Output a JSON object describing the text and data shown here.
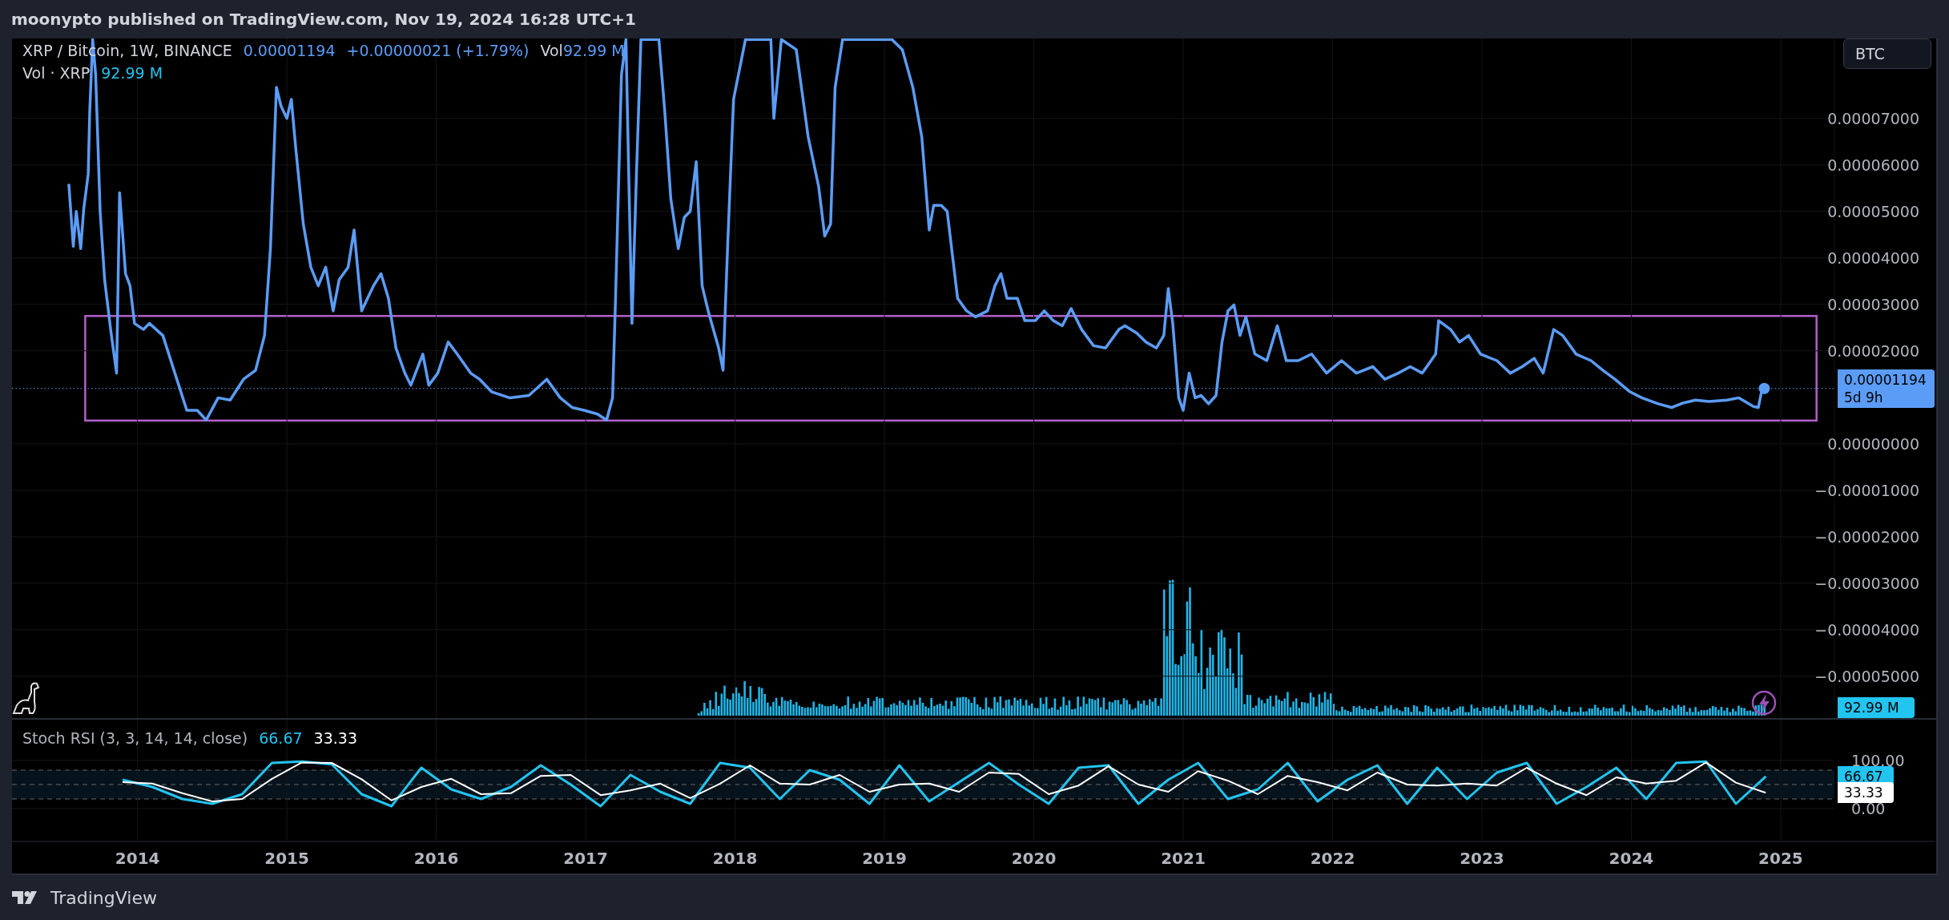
{
  "header": {
    "publisher_line": "moonypto published on TradingView.com, Nov 19, 2024 16:28 UTC+1"
  },
  "legend": {
    "symbol": "XRP / Bitcoin, 1W, BINANCE",
    "price": "0.00001194",
    "change": "+0.00000021 (+1.79%)",
    "volume_label": "Vol",
    "volume_value": "92.99 M"
  },
  "volume_legend": {
    "name": "Vol · XRP",
    "value": "92.99 M"
  },
  "currency_button": "BTC",
  "price_chart": {
    "last_price_label": "0.00001194",
    "countdown": "5d 9h",
    "volume_axis_label": "92.99 M",
    "chart_data": {
      "type": "line",
      "grid": true,
      "xlim": [
        2013.16,
        2026.03
      ],
      "ylim": [
        -5.9e-05,
        8.72e-05
      ],
      "x": [
        2013.54,
        2013.57,
        2013.59,
        2013.62,
        2013.64,
        2013.67,
        2013.68,
        2013.7,
        2013.72,
        2013.75,
        2013.78,
        2013.82,
        2013.86,
        2013.88,
        2013.92,
        2013.95,
        2013.98,
        2014.04,
        2014.08,
        2014.17,
        2014.25,
        2014.33,
        2014.4,
        2014.46,
        2014.54,
        2014.62,
        2014.71,
        2014.79,
        2014.85,
        2014.89,
        2014.93,
        2014.96,
        2015.0,
        2015.03,
        2015.06,
        2015.11,
        2015.16,
        2015.21,
        2015.26,
        2015.31,
        2015.35,
        2015.41,
        2015.45,
        2015.5,
        2015.54,
        2015.58,
        2015.63,
        2015.68,
        2015.73,
        2015.79,
        2015.83,
        2015.91,
        2015.95,
        2016.01,
        2016.08,
        2016.14,
        2016.23,
        2016.29,
        2016.37,
        2016.49,
        2016.62,
        2016.74,
        2016.83,
        2016.91,
        2016.99,
        2017.08,
        2017.14,
        2017.18,
        2017.2,
        2017.22,
        2017.24,
        2017.27,
        2017.29,
        2017.31,
        2017.34,
        2017.37,
        2017.49,
        2017.53,
        2017.57,
        2017.62,
        2017.66,
        2017.7,
        2017.74,
        2017.78,
        2017.82,
        2017.89,
        2017.92,
        2017.95,
        2017.99,
        2018.07,
        2018.24,
        2018.26,
        2018.31,
        2018.41,
        2018.49,
        2018.56,
        2018.6,
        2018.64,
        2018.67,
        2018.72,
        2018.82,
        2018.9,
        2019.05,
        2019.12,
        2019.19,
        2019.25,
        2019.3,
        2019.33,
        2019.38,
        2019.42,
        2019.49,
        2019.55,
        2019.61,
        2019.69,
        2019.74,
        2019.78,
        2019.82,
        2019.89,
        2019.94,
        2020.01,
        2020.07,
        2020.13,
        2020.19,
        2020.25,
        2020.32,
        2020.4,
        2020.48,
        2020.57,
        2020.61,
        2020.69,
        2020.75,
        2020.82,
        2020.87,
        2020.9,
        2020.93,
        2020.97,
        2021.0,
        2021.04,
        2021.08,
        2021.12,
        2021.17,
        2021.22,
        2021.26,
        2021.3,
        2021.34,
        2021.38,
        2021.42,
        2021.48,
        2021.56,
        2021.63,
        2021.69,
        2021.77,
        2021.86,
        2021.96,
        2022.06,
        2022.16,
        2022.27,
        2022.35,
        2022.44,
        2022.52,
        2022.6,
        2022.69,
        2022.71,
        2022.79,
        2022.85,
        2022.91,
        2022.99,
        2023.1,
        2023.19,
        2023.27,
        2023.35,
        2023.41,
        2023.48,
        2023.54,
        2023.63,
        2023.73,
        2023.81,
        2023.89,
        2023.99,
        2024.07,
        2024.18,
        2024.27,
        2024.35,
        2024.43,
        2024.52,
        2024.64,
        2024.72,
        2024.82,
        2024.85,
        2024.87,
        2024.89
      ],
      "values": [
        5.59e-05,
        4.25e-05,
        5e-05,
        4.2e-05,
        5.05e-05,
        5.8e-05,
        7.14e-05,
        8.7e-05,
        7.94e-05,
        5e-05,
        3.53e-05,
        2.46e-05,
        1.52e-05,
        5.4e-05,
        3.66e-05,
        3.4e-05,
        2.59e-05,
        2.46e-05,
        2.59e-05,
        2.33e-05,
        1.52e-05,
        7.2e-06,
        7.2e-06,
        5.1e-06,
        9.9e-06,
        9.4e-06,
        1.39e-05,
        1.58e-05,
        2.33e-05,
        4.2e-05,
        7.67e-05,
        7.27e-05,
        7e-05,
        7.41e-05,
        6.34e-05,
        4.73e-05,
        3.8e-05,
        3.4e-05,
        3.8e-05,
        2.86e-05,
        3.53e-05,
        3.8e-05,
        4.6e-05,
        2.86e-05,
        3.13e-05,
        3.4e-05,
        3.66e-05,
        3.13e-05,
        2.06e-05,
        1.52e-05,
        1.26e-05,
        1.93e-05,
        1.26e-05,
        1.52e-05,
        2.19e-05,
        1.93e-05,
        1.52e-05,
        1.39e-05,
        1.12e-05,
        9.9e-06,
        1.04e-05,
        1.39e-05,
        9.9e-06,
        7.8e-06,
        7.2e-06,
        6.4e-06,
        5.1e-06,
        9.9e-06,
        3.13e-05,
        5.53e-05,
        7.94e-05,
        8.7e-05,
        5.53e-05,
        2.59e-05,
        5.8e-05,
        8.7e-05,
        8.7e-05,
        7.14e-05,
        5.27e-05,
        4.2e-05,
        4.87e-05,
        5e-05,
        6.07e-05,
        3.4e-05,
        2.86e-05,
        2.06e-05,
        1.58e-05,
        4.2e-05,
        7.41e-05,
        8.7e-05,
        8.7e-05,
        7e-05,
        8.7e-05,
        8.48e-05,
        6.6e-05,
        5.53e-05,
        4.47e-05,
        4.73e-05,
        7.67e-05,
        8.7e-05,
        8.7e-05,
        8.7e-05,
        8.7e-05,
        8.48e-05,
        7.67e-05,
        6.6e-05,
        4.6e-05,
        5.13e-05,
        5.13e-05,
        5e-05,
        3.13e-05,
        2.86e-05,
        2.73e-05,
        2.86e-05,
        3.4e-05,
        3.66e-05,
        3.13e-05,
        3.13e-05,
        2.65e-05,
        2.65e-05,
        2.86e-05,
        2.65e-05,
        2.54e-05,
        2.91e-05,
        2.46e-05,
        2.11e-05,
        2.06e-05,
        2.46e-05,
        2.54e-05,
        2.38e-05,
        2.19e-05,
        2.06e-05,
        2.33e-05,
        3.34e-05,
        2.59e-05,
        9.9e-06,
        7.2e-06,
        1.52e-05,
        9.9e-06,
        1.04e-05,
        8.6e-06,
        1.04e-05,
        2.19e-05,
        2.86e-05,
        2.99e-05,
        2.33e-05,
        2.73e-05,
        1.93e-05,
        1.79e-05,
        2.54e-05,
        1.79e-05,
        1.79e-05,
        1.93e-05,
        1.52e-05,
        1.79e-05,
        1.52e-05,
        1.66e-05,
        1.39e-05,
        1.52e-05,
        1.66e-05,
        1.52e-05,
        1.93e-05,
        2.65e-05,
        2.46e-05,
        2.19e-05,
        2.33e-05,
        1.93e-05,
        1.79e-05,
        1.52e-05,
        1.66e-05,
        1.84e-05,
        1.52e-05,
        2.46e-05,
        2.33e-05,
        1.93e-05,
        1.79e-05,
        1.58e-05,
        1.39e-05,
        1.12e-05,
        9.9e-06,
        8.6e-06,
        7.8e-06,
        8.8e-06,
        9.4e-06,
        9.1e-06,
        9.4e-06,
        9.9e-06,
        8e-06,
        7.8e-06,
        1.1e-05,
        1.19e-05
      ],
      "yticks": [
        {
          "value": 7e-05,
          "label": "0.00007000"
        },
        {
          "value": 6e-05,
          "label": "0.00006000"
        },
        {
          "value": 5e-05,
          "label": "0.00005000"
        },
        {
          "value": 4e-05,
          "label": "0.00004000"
        },
        {
          "value": 3e-05,
          "label": "0.00003000"
        },
        {
          "value": 2e-05,
          "label": "0.00002000"
        },
        {
          "value": 0,
          "label": "0.00000000"
        },
        {
          "value": -1e-05,
          "label": "−0.00001000"
        },
        {
          "value": -2e-05,
          "label": "−0.00002000"
        },
        {
          "value": -3e-05,
          "label": "−0.00003000"
        },
        {
          "value": -4e-05,
          "label": "−0.00004000"
        },
        {
          "value": -5e-05,
          "label": "−0.00005000"
        }
      ]
    }
  },
  "stoch_rsi": {
    "title": "Stoch RSI (3, 3, 14, 14, close)",
    "k_value": "66.67",
    "d_value": "33.33",
    "k_axis_label": "66.67",
    "d_axis_label": "33.33",
    "chart_data": {
      "type": "line",
      "grid": true,
      "xlim": [
        2013.16,
        2026.03
      ],
      "ylim": [
        0,
        100
      ],
      "x": [
        2013.9,
        2014.1,
        2014.3,
        2014.5,
        2014.7,
        2014.9,
        2015.1,
        2015.3,
        2015.5,
        2015.7,
        2015.9,
        2016.1,
        2016.3,
        2016.5,
        2016.7,
        2016.9,
        2017.1,
        2017.3,
        2017.5,
        2017.7,
        2017.9,
        2018.1,
        2018.3,
        2018.5,
        2018.7,
        2018.9,
        2019.1,
        2019.3,
        2019.5,
        2019.7,
        2019.9,
        2020.1,
        2020.3,
        2020.5,
        2020.7,
        2020.9,
        2021.1,
        2021.3,
        2021.5,
        2021.7,
        2021.9,
        2022.1,
        2022.3,
        2022.5,
        2022.7,
        2022.9,
        2023.1,
        2023.3,
        2023.5,
        2023.7,
        2023.9,
        2024.1,
        2024.3,
        2024.5,
        2024.7,
        2024.9
      ],
      "series": [
        {
          "color": "#22c4f0",
          "values": [
            60,
            45,
            20,
            10,
            30,
            95,
            98,
            92,
            30,
            5,
            85,
            40,
            20,
            45,
            90,
            50,
            5,
            70,
            35,
            10,
            95,
            85,
            20,
            80,
            60,
            10,
            90,
            15,
            55,
            95,
            50,
            10,
            85,
            90,
            10,
            60,
            95,
            20,
            40,
            95,
            15,
            60,
            90,
            10,
            85,
            20,
            75,
            95,
            10,
            45,
            85,
            20,
            95,
            98,
            10,
            67
          ]
        },
        {
          "color": "#ffffff",
          "values": [
            55,
            52,
            32,
            15,
            20,
            62,
            96,
            95,
            61,
            17,
            45,
            62,
            30,
            32,
            68,
            70,
            28,
            38,
            52,
            22,
            52,
            90,
            52,
            50,
            70,
            35,
            50,
            52,
            35,
            75,
            72,
            30,
            48,
            88,
            50,
            35,
            78,
            58,
            30,
            68,
            55,
            38,
            75,
            50,
            48,
            52,
            48,
            85,
            52,
            28,
            65,
            52,
            58,
            96,
            54,
            33
          ]
        }
      ],
      "yticks": [
        {
          "value": 100,
          "label": "100.00"
        },
        {
          "value": 0,
          "label": "0.00"
        }
      ],
      "xticks": [
        {
          "value": 2014,
          "label": "2014"
        },
        {
          "value": 2015,
          "label": "2015"
        },
        {
          "value": 2016,
          "label": "2016"
        },
        {
          "value": 2017,
          "label": "2017"
        },
        {
          "value": 2018,
          "label": "2018"
        },
        {
          "value": 2019,
          "label": "2019"
        },
        {
          "value": 2020,
          "label": "2020"
        },
        {
          "value": 2021,
          "label": "2021"
        },
        {
          "value": 2022,
          "label": "2022"
        },
        {
          "value": 2023,
          "label": "2023"
        },
        {
          "value": 2024,
          "label": "2024"
        },
        {
          "value": 2025,
          "label": "2025"
        }
      ]
    }
  },
  "footer": {
    "brand": "TradingView"
  }
}
